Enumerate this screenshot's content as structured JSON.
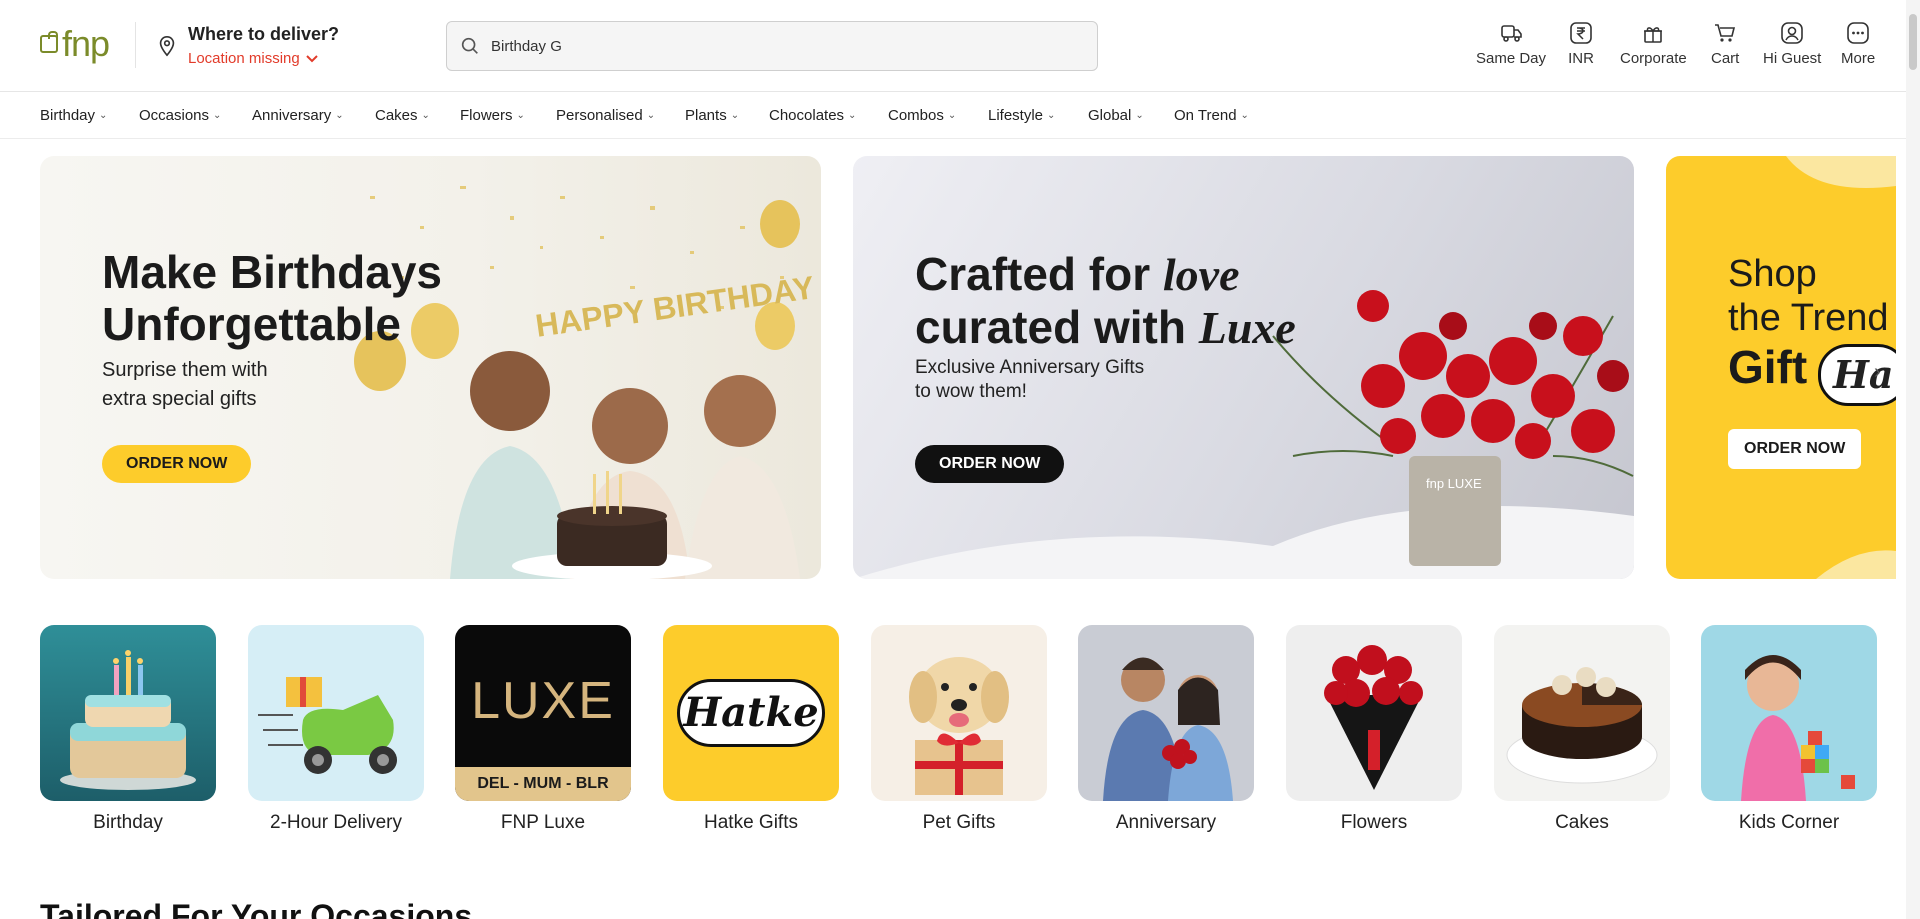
{
  "brand": {
    "logo_text": "fnp"
  },
  "location": {
    "title": "Where to deliver?",
    "status": "Location missing"
  },
  "search": {
    "value": "Birthday G"
  },
  "top_nav": [
    {
      "label": "Same Day",
      "icon": "truck-icon"
    },
    {
      "label": "INR",
      "icon": "rupee-icon"
    },
    {
      "label": "Corporate",
      "icon": "gift-group-icon"
    },
    {
      "label": "Cart",
      "icon": "cart-icon"
    },
    {
      "label": "Hi Guest",
      "icon": "user-icon"
    },
    {
      "label": "More",
      "icon": "more-icon"
    }
  ],
  "categories_nav": [
    "Birthday",
    "Occasions",
    "Anniversary",
    "Cakes",
    "Flowers",
    "Personalised",
    "Plants",
    "Chocolates",
    "Combos",
    "Lifestyle",
    "Global",
    "On Trend"
  ],
  "banners": [
    {
      "title_line1": "Make Birthdays",
      "title_line2": "Unforgettable",
      "subtitle_line1": "Surprise them with",
      "subtitle_line2": "extra special gifts",
      "decor_text": "HAPPY BIRTHDAY",
      "cta": "ORDER NOW"
    },
    {
      "title_line1": "Crafted for ",
      "title_italic1": "love",
      "title_line2": "curated with ",
      "title_italic2": "Luxe",
      "subtitle_line1": "Exclusive Anniversary Gifts",
      "subtitle_line2": "to wow them!",
      "vase_text": "fnp LUXE",
      "cta": "ORDER NOW"
    },
    {
      "title_line1": "Shop",
      "title_line2": "the Trend",
      "title_line3": "Gift",
      "badge": "Ha",
      "cta": "ORDER NOW"
    }
  ],
  "tiles": [
    {
      "label": "Birthday"
    },
    {
      "label": "2-Hour Delivery"
    },
    {
      "label": "FNP Luxe",
      "logo": "LUXE",
      "cities": "DEL - MUM - BLR"
    },
    {
      "label": "Hatke Gifts",
      "logo": "Hatke"
    },
    {
      "label": "Pet Gifts"
    },
    {
      "label": "Anniversary"
    },
    {
      "label": "Flowers"
    },
    {
      "label": "Cakes"
    },
    {
      "label": "Kids Corner"
    }
  ],
  "section": {
    "title": "Tailored For Your Occasions"
  },
  "colors": {
    "brand_olive": "#7b8b2a",
    "alert_red": "#e23b2a",
    "cta_yellow": "#fdcc2b",
    "dark": "#111111"
  }
}
